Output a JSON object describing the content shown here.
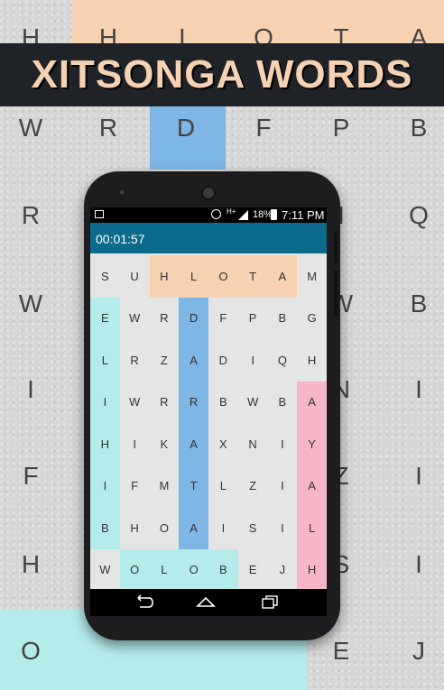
{
  "banner": {
    "title": "XITSONGA WORDS"
  },
  "background_letters": [
    {
      "t": "H",
      "r": 0,
      "c": 0
    },
    {
      "t": "H",
      "r": 0,
      "c": 1
    },
    {
      "t": "L",
      "r": 0,
      "c": 2
    },
    {
      "t": "O",
      "r": 0,
      "c": 3
    },
    {
      "t": "T",
      "r": 0,
      "c": 4
    },
    {
      "t": "A",
      "r": 0,
      "c": 5
    },
    {
      "t": "W",
      "r": 1,
      "c": 0
    },
    {
      "t": "R",
      "r": 1,
      "c": 1
    },
    {
      "t": "D",
      "r": 1,
      "c": 2
    },
    {
      "t": "F",
      "r": 1,
      "c": 3
    },
    {
      "t": "P",
      "r": 1,
      "c": 4
    },
    {
      "t": "B",
      "r": 1,
      "c": 5
    },
    {
      "t": "R",
      "r": 2,
      "c": 0
    },
    {
      "t": "I",
      "r": 2,
      "c": 4
    },
    {
      "t": "Q",
      "r": 2,
      "c": 5
    },
    {
      "t": "W",
      "r": 3,
      "c": 0
    },
    {
      "t": "W",
      "r": 3,
      "c": 4
    },
    {
      "t": "B",
      "r": 3,
      "c": 5
    },
    {
      "t": "I",
      "r": 4,
      "c": 0
    },
    {
      "t": "N",
      "r": 4,
      "c": 4
    },
    {
      "t": "I",
      "r": 4,
      "c": 5
    },
    {
      "t": "F",
      "r": 5,
      "c": 0
    },
    {
      "t": "Z",
      "r": 5,
      "c": 4
    },
    {
      "t": "I",
      "r": 5,
      "c": 5
    },
    {
      "t": "H",
      "r": 6,
      "c": 0
    },
    {
      "t": "S",
      "r": 6,
      "c": 4
    },
    {
      "t": "I",
      "r": 6,
      "c": 5
    },
    {
      "t": "O",
      "r": 7,
      "c": 0
    },
    {
      "t": "E",
      "r": 7,
      "c": 4
    },
    {
      "t": "J",
      "r": 7,
      "c": 5
    }
  ],
  "status_bar": {
    "battery": "18%",
    "time": "7:11 PM",
    "network": "H+"
  },
  "timer": "00:01:57",
  "colors": {
    "peach": "#f6d2b2",
    "cyan": "#b4ecec",
    "blue": "#7eb6e6",
    "pink": "#f7b6c8",
    "header": "#0c6a8c"
  },
  "grid": [
    [
      "S",
      "U",
      "H",
      "L",
      "O",
      "T",
      "A",
      "M"
    ],
    [
      "E",
      "W",
      "R",
      "D",
      "F",
      "P",
      "B",
      "G"
    ],
    [
      "L",
      "R",
      "Z",
      "A",
      "D",
      "I",
      "Q",
      "H"
    ],
    [
      "I",
      "W",
      "R",
      "R",
      "B",
      "W",
      "B",
      "A"
    ],
    [
      "H",
      "I",
      "K",
      "A",
      "X",
      "N",
      "I",
      "Y"
    ],
    [
      "I",
      "F",
      "M",
      "T",
      "L",
      "Z",
      "I",
      "A"
    ],
    [
      "B",
      "H",
      "O",
      "A",
      "I",
      "S",
      "I",
      "L"
    ],
    [
      "W",
      "O",
      "L",
      "O",
      "B",
      "E",
      "J",
      "H"
    ]
  ],
  "found_words": [
    {
      "word": "HLOTA",
      "color": "peach",
      "row": 0,
      "col": 2,
      "dir": "h",
      "len": 5
    },
    {
      "word": "ELIHIB",
      "color": "cyan",
      "row": 1,
      "col": 0,
      "dir": "v",
      "len": 6
    },
    {
      "word": "DARATA",
      "color": "blue",
      "row": 1,
      "col": 3,
      "dir": "v",
      "len": 6
    },
    {
      "word": "AYALH",
      "color": "pink",
      "row": 3,
      "col": 7,
      "dir": "v",
      "len": 5
    },
    {
      "word": "OLOB",
      "color": "cyan",
      "row": 7,
      "col": 1,
      "dir": "h",
      "len": 4
    }
  ]
}
